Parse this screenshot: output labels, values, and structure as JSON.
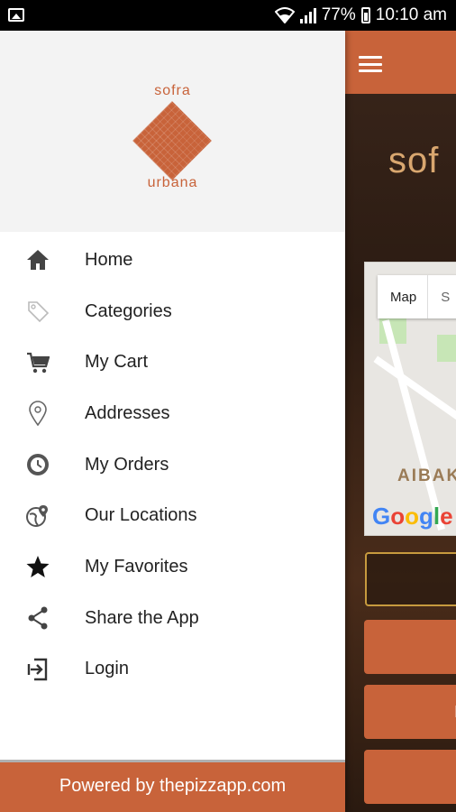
{
  "status_bar": {
    "battery": "77%",
    "time": "10:10 am"
  },
  "brand": {
    "top": "sofra",
    "bottom": "urbana",
    "accent_color": "#c8633a"
  },
  "menu": {
    "items": [
      {
        "label": "Home",
        "icon": "home-icon"
      },
      {
        "label": "Categories",
        "icon": "tag-icon"
      },
      {
        "label": "My Cart",
        "icon": "cart-icon"
      },
      {
        "label": "Addresses",
        "icon": "location-pin-icon"
      },
      {
        "label": "My Orders",
        "icon": "history-icon"
      },
      {
        "label": "Our Locations",
        "icon": "globe-pin-icon"
      },
      {
        "label": "My Favorites",
        "icon": "star-icon"
      },
      {
        "label": "Share the App",
        "icon": "share-icon"
      },
      {
        "label": "Login",
        "icon": "login-icon"
      }
    ]
  },
  "footer": {
    "text": "Powered by thepizzapp.com"
  },
  "background_app": {
    "logo_partial": "sof",
    "map": {
      "type_option": "Map",
      "type_option_2": "S",
      "area_label": "AIBAK",
      "google": "Google"
    },
    "button_text_partial": "I"
  }
}
